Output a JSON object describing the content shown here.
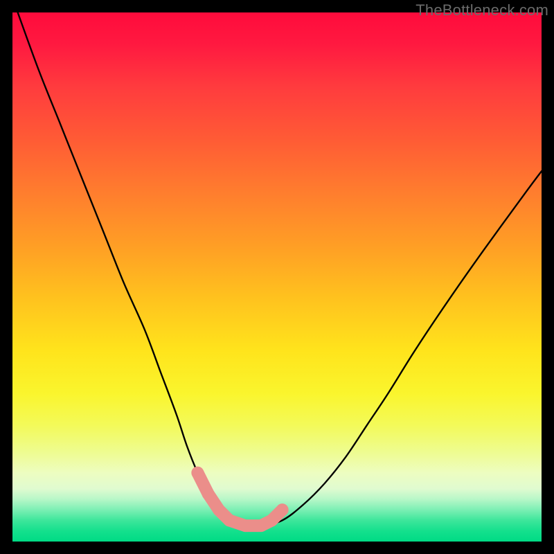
{
  "watermark": "TheBottleneck.com",
  "colors": {
    "curve_stroke": "#000000",
    "marker_stroke": "#eb8e8a",
    "marker_fill": "#eb8e8a"
  },
  "chart_data": {
    "type": "line",
    "title": "",
    "xlabel": "",
    "ylabel": "",
    "xlim": [
      0,
      100
    ],
    "ylim": [
      0,
      100
    ],
    "series": [
      {
        "name": "bottleneck-curve",
        "x": [
          1,
          5,
          9,
          13,
          17,
          21,
          25,
          28,
          31,
          33,
          35,
          37,
          39,
          41,
          44,
          47,
          51,
          55,
          59,
          63,
          67,
          71,
          76,
          82,
          89,
          97,
          100
        ],
        "values": [
          100,
          89,
          79,
          69,
          59,
          49,
          40,
          32,
          24,
          18,
          13,
          9,
          6,
          4,
          3,
          3,
          4,
          7,
          11,
          16,
          22,
          28,
          36,
          45,
          55,
          66,
          70
        ]
      }
    ],
    "annotations": [
      {
        "name": "trough-markers",
        "x": [
          35,
          37,
          39,
          41,
          44,
          47,
          49,
          51
        ],
        "values": [
          13,
          9,
          6,
          4,
          3,
          3,
          4,
          6
        ]
      }
    ]
  }
}
